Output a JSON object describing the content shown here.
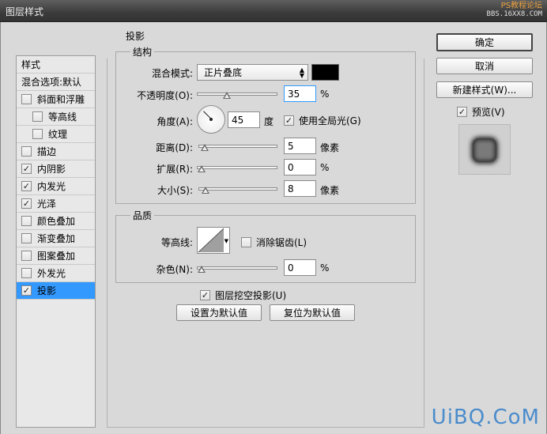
{
  "window": {
    "title": "图层样式",
    "watermark_top": "PS教程论坛",
    "watermark_sub": "BBS.16XX8.COM",
    "watermark_bottom": "UiBQ.CoM"
  },
  "style_list": {
    "header": "样式",
    "blend_options": "混合选项:默认",
    "items": [
      {
        "label": "斜面和浮雕",
        "checked": false
      },
      {
        "label": "等高线",
        "checked": false
      },
      {
        "label": "纹理",
        "checked": false
      },
      {
        "label": "描边",
        "checked": false
      },
      {
        "label": "内阴影",
        "checked": true
      },
      {
        "label": "内发光",
        "checked": true
      },
      {
        "label": "光泽",
        "checked": true
      },
      {
        "label": "颜色叠加",
        "checked": false
      },
      {
        "label": "渐变叠加",
        "checked": false
      },
      {
        "label": "图案叠加",
        "checked": false
      },
      {
        "label": "外发光",
        "checked": false
      },
      {
        "label": "投影",
        "checked": true,
        "selected": true
      }
    ]
  },
  "drop_shadow": {
    "title": "投影",
    "structure": {
      "title": "结构",
      "blend_mode_label": "混合模式:",
      "blend_mode_value": "正片叠底",
      "color": "#000000",
      "opacity_label": "不透明度(O):",
      "opacity_value": "35",
      "opacity_unit": "%",
      "opacity_fraction": 0.35,
      "angle_label": "角度(A):",
      "angle_value": "45",
      "angle_unit": "度",
      "global_light_label": "使用全局光(G)",
      "global_light_checked": true,
      "distance_label": "距离(D):",
      "distance_value": "5",
      "distance_unit": "像素",
      "distance_fraction": 0.02,
      "spread_label": "扩展(R):",
      "spread_value": "0",
      "spread_unit": "%",
      "spread_fraction": 0.0,
      "size_label": "大小(S):",
      "size_value": "8",
      "size_unit": "像素",
      "size_fraction": 0.03
    },
    "quality": {
      "title": "品质",
      "contour_label": "等高线:",
      "anti_alias_label": "消除锯齿(L)",
      "anti_alias_checked": false,
      "noise_label": "杂色(N):",
      "noise_value": "0",
      "noise_unit": "%",
      "noise_fraction": 0.0
    },
    "knockout_label": "图层挖空投影(U)",
    "knockout_checked": true,
    "make_default": "设置为默认值",
    "reset_default": "复位为默认值"
  },
  "buttons": {
    "ok": "确定",
    "cancel": "取消",
    "new_style": "新建样式(W)..."
  },
  "preview": {
    "label": "预览(V)",
    "checked": true
  }
}
